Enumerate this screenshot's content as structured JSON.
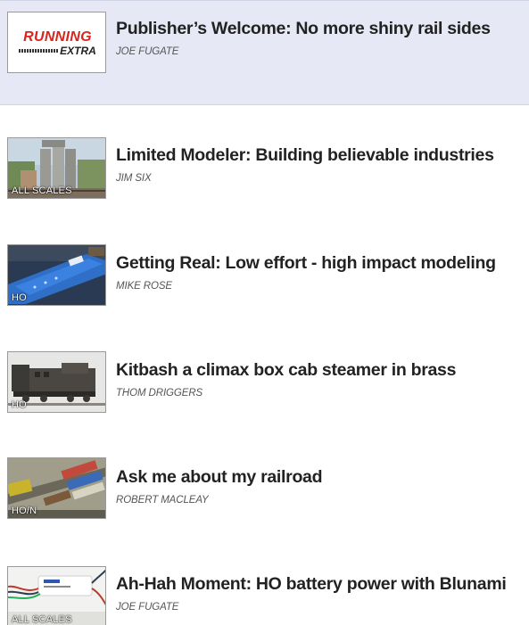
{
  "articles": [
    {
      "title": "Publisher’s Welcome: No more shiny rail sides",
      "author": "JOE FUGATE",
      "thumbnail": "running-extra-logo",
      "logo": {
        "top": "RUNNING",
        "bottom": "EXTRA"
      },
      "scale": "",
      "selected": true
    },
    {
      "title": "Limited Modeler: Building believable industries",
      "author": "JIM SIX",
      "thumbnail": "grain-elevator-photo",
      "scale": "ALL SCALES",
      "selected": false
    },
    {
      "title": "Getting Real: Low effort - high impact modeling",
      "author": "MIKE ROSE",
      "thumbnail": "blue-gt-boxcar-photo",
      "scale": "HO",
      "selected": false
    },
    {
      "title": "Kitbash a climax box cab steamer in brass",
      "author": "THOM DRIGGERS",
      "thumbnail": "brass-locomotive-photo",
      "scale": "HO",
      "selected": false
    },
    {
      "title": "Ask me about my railroad",
      "author": "ROBERT MACLEAY",
      "thumbnail": "layout-yard-photo",
      "scale": "HO/N",
      "selected": false
    },
    {
      "title": "Ah-Hah Moment: HO battery power with Blunami",
      "author": "JOE FUGATE",
      "thumbnail": "blunami-decoder-photo",
      "scale": "ALL SCALES",
      "selected": false
    }
  ],
  "colors": {
    "selected_row_bg": "#e6e9f5",
    "title_text": "#222222",
    "author_text": "#555555",
    "logo_red": "#d9251c"
  }
}
